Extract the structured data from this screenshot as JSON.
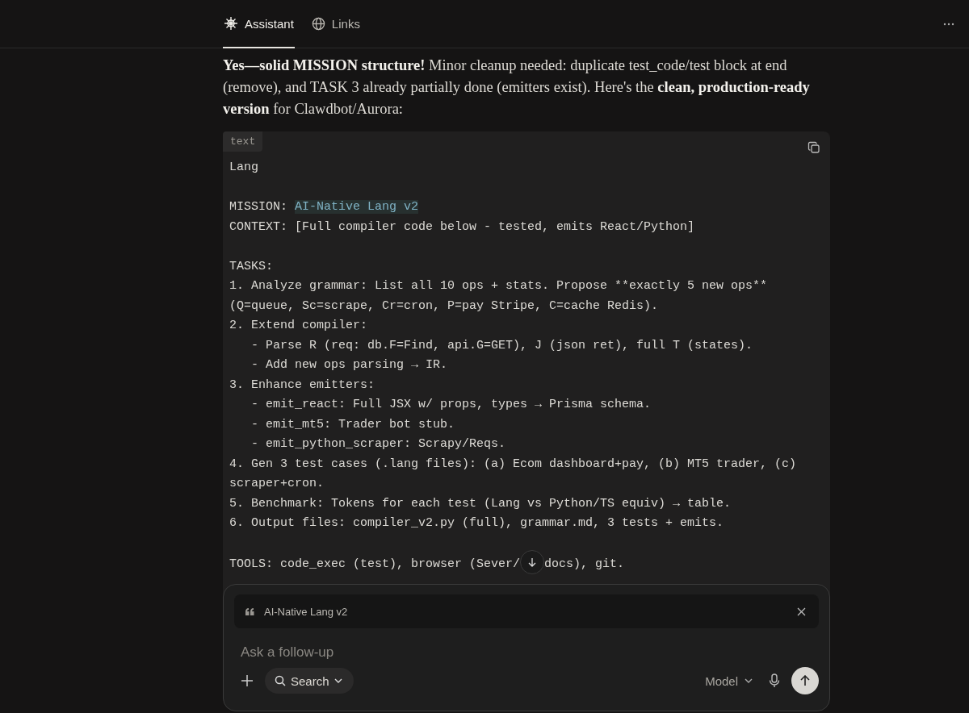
{
  "tabs": [
    {
      "label": "Assistant",
      "selected": true
    },
    {
      "label": "Links",
      "selected": false
    }
  ],
  "message": "**Yes—solid MISSION structure!** Minor cleanup needed: duplicate test_code/test block at end (remove), and TASK 3 already partially done (emitters exist). Here's the **clean, production-ready version** for Clawdbot/Aurora:",
  "code_block": {
    "language": "text",
    "lines": [
      {
        "kind": "plain",
        "text": "Lang"
      },
      {
        "kind": "blank"
      },
      {
        "kind": "highlighted",
        "text": "MISSION: ",
        "highlight": "AI-Native Lang v2"
      },
      {
        "kind": "plain",
        "text": "CONTEXT: [Full compiler code below - tested, emits React/Python]"
      },
      {
        "kind": "blank"
      },
      {
        "kind": "plain",
        "text": "TASKS:"
      },
      {
        "kind": "plain",
        "text": "1. Analyze grammar: List all 10 ops + stats. Propose **exactly 5 new ops** (Q=queue, Sc=scrape, Cr=cron, P=pay Stripe, C=cache Redis)."
      },
      {
        "kind": "plain",
        "text": "2. Extend compiler:"
      },
      {
        "kind": "indented",
        "text": "- Parse R (req: db.F=Find, api.G=GET), J (json ret), full T (states)."
      },
      {
        "kind": "indented",
        "text": "- Add new ops parsing → IR."
      },
      {
        "kind": "plain",
        "text": "3. Enhance emitters:"
      },
      {
        "kind": "indented",
        "text": "- emit_react: Full JSX w/ props, types → Prisma schema."
      },
      {
        "kind": "indented",
        "text": "- emit_mt5: Trader bot stub."
      },
      {
        "kind": "indented",
        "text": "- emit_python_scraper: Scrapy/Reqs."
      },
      {
        "kind": "plain",
        "text": "4. Gen 3 test cases (.lang files): (a) Ecom dashboard+pay, (b) MT5 trader, (c) scraper+cron."
      },
      {
        "kind": "plain",
        "text": "5. Benchmark: Tokens for each test (Lang vs Python/TS equiv) → table."
      },
      {
        "kind": "plain",
        "text": "6. Output files: compiler_v2.py (full), grammar.md, 3 tests + emits."
      },
      {
        "kind": "blank"
      },
      {
        "kind": "covered",
        "text": "TOOLS: code_exec (test), browser (Sever/",
        "after": "docs), git."
      }
    ]
  },
  "composer": {
    "quote": "AI-Native Lang v2",
    "placeholder": "Ask a follow-up",
    "search_label": "Search",
    "model_label": "Model"
  }
}
